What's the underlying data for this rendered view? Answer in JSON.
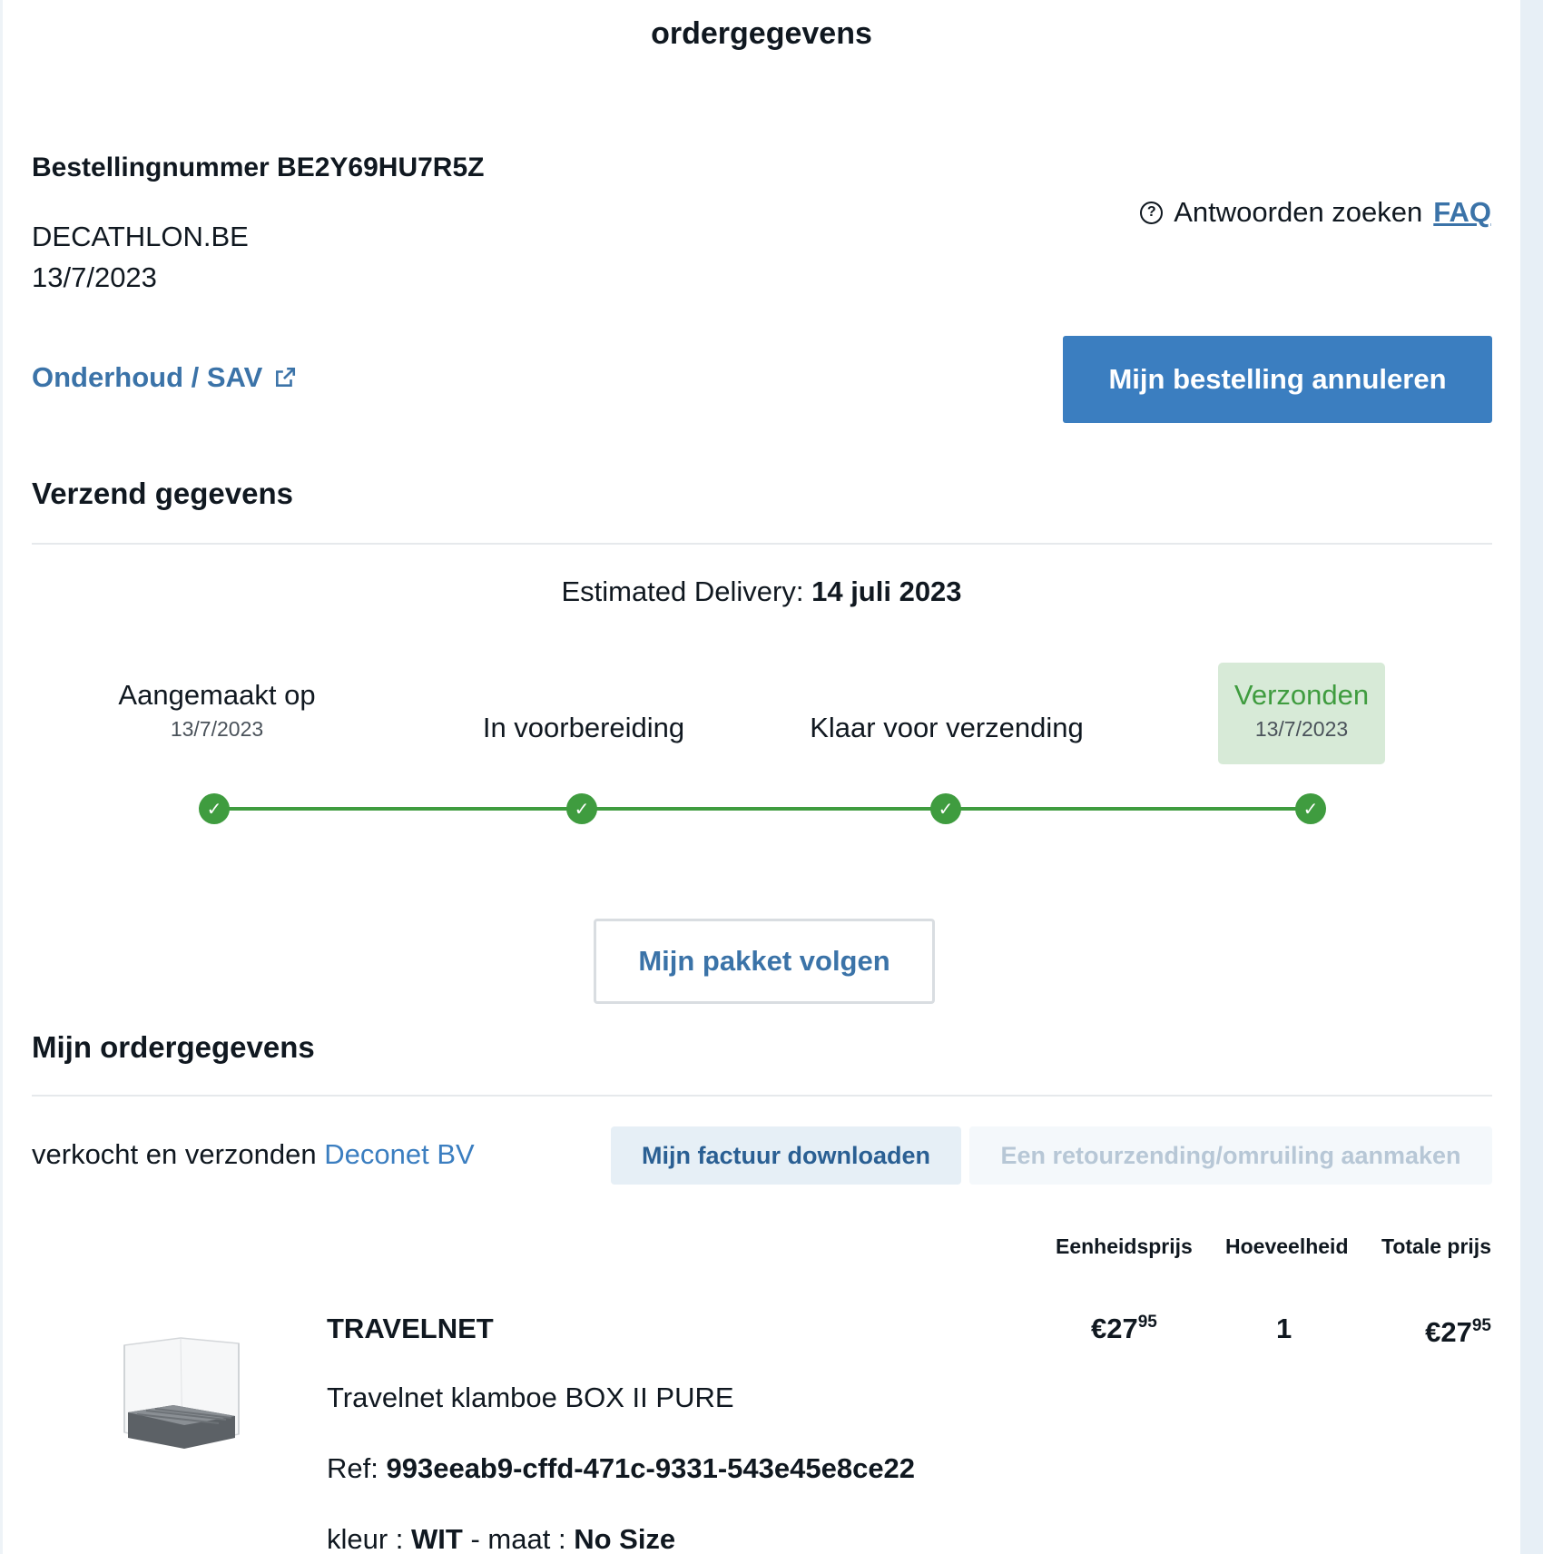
{
  "page": {
    "title": "ordergegevens"
  },
  "order": {
    "number_label": "Bestellingnummer BE2Y69HU7R5Z",
    "store": "DECATHLON.BE",
    "date": "13/7/2023",
    "faq_text": "Antwoorden zoeken",
    "faq_link": "FAQ",
    "sav_link": "Onderhoud / SAV",
    "cancel_label": "Mijn bestelling annuleren"
  },
  "shipping": {
    "heading": "Verzend gegevens",
    "estimated_label": "Estimated Delivery:",
    "estimated_date": "14 juli 2023",
    "steps": [
      {
        "label": "Aangemaakt op",
        "date": "13/7/2023"
      },
      {
        "label": "In voorbereiding",
        "date": ""
      },
      {
        "label": "Klaar voor verzending",
        "date": ""
      },
      {
        "label": "Verzonden",
        "date": "13/7/2023"
      }
    ],
    "track_label": "Mijn pakket volgen"
  },
  "order_details": {
    "heading": "Mijn ordergegevens",
    "seller_prefix": "verkocht en verzonden",
    "seller_name": "Deconet BV",
    "invoice_label": "Mijn factuur downloaden",
    "return_label": "Een retourzending/omruiling aanmaken",
    "columns": [
      "Eenheidsprijs",
      "Hoeveelheid",
      "Totale prijs"
    ],
    "item": {
      "name": "TRAVELNET",
      "description": "Travelnet klamboe BOX II PURE",
      "ref_label": "Ref:",
      "ref_value": "993eeab9-cffd-471c-9331-543e45e8ce22",
      "color_label": "kleur :",
      "color_value": "WIT",
      "size_label": "- maat :",
      "size_value": "No Size",
      "unit_price_main": "€27",
      "unit_price_cents": "95",
      "quantity": "1",
      "total_price_main": "€27",
      "total_price_cents": "95"
    }
  },
  "colors": {
    "primary": "#3b7ec0",
    "link": "#3b73a8",
    "success": "#3f9c3f",
    "success_bg": "#d7ead7"
  }
}
